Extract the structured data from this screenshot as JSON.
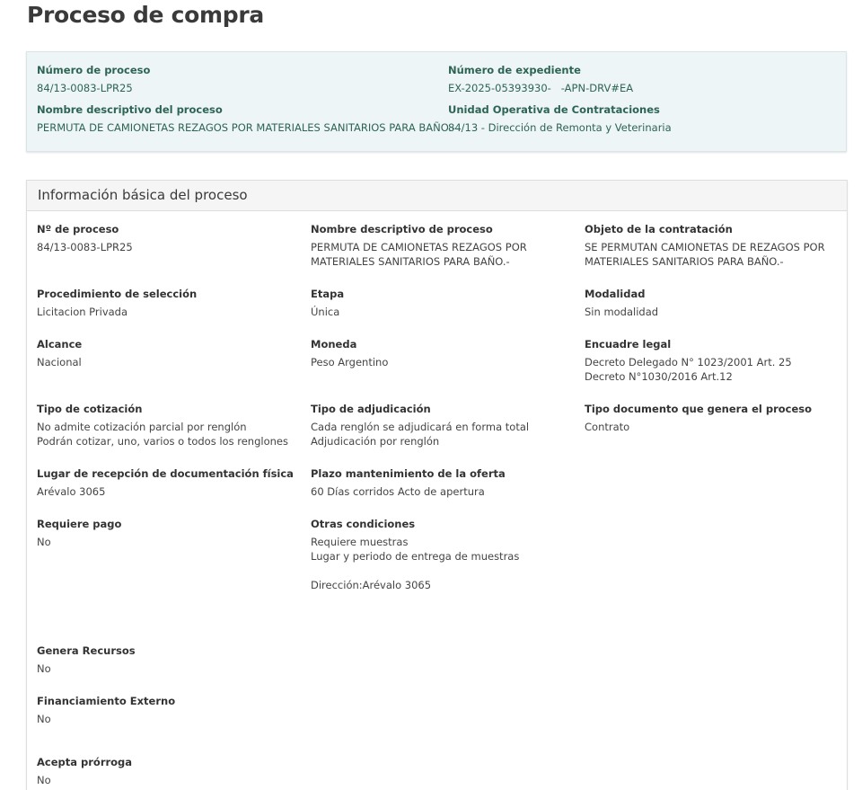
{
  "page": {
    "title": "Proceso de compra"
  },
  "summary": {
    "numero_proceso": {
      "label": "Número de proceso",
      "value": "84/13-0083-LPR25"
    },
    "numero_expediente": {
      "label": "Número de expediente",
      "value": "EX-2025-05393930-   -APN-DRV#EA"
    },
    "nombre_descriptivo": {
      "label": "Nombre descriptivo del proceso",
      "value": "PERMUTA DE CAMIONETAS REZAGOS POR MATERIALES SANITARIOS PARA BAÑO.-"
    },
    "unidad_operativa": {
      "label": "Unidad Operativa de Contrataciones",
      "value": "84/13 - Dirección de Remonta y Veterinaria"
    }
  },
  "info": {
    "title": "Información básica del proceso",
    "nro_proceso": {
      "label": "Nº de proceso",
      "lines": [
        "84/13-0083-LPR25"
      ]
    },
    "nombre_descriptivo": {
      "label": "Nombre descriptivo de proceso",
      "lines": [
        "PERMUTA DE CAMIONETAS REZAGOS POR",
        "MATERIALES SANITARIOS PARA BAÑO.-"
      ]
    },
    "objeto": {
      "label": "Objeto de la contratación",
      "lines": [
        "SE PERMUTAN CAMIONETAS DE REZAGOS POR",
        "MATERIALES SANITARIOS PARA BAÑO.-"
      ]
    },
    "procedimiento": {
      "label": "Procedimiento de selección",
      "lines": [
        "Licitacion Privada"
      ]
    },
    "etapa": {
      "label": "Etapa",
      "lines": [
        "Única"
      ]
    },
    "modalidad": {
      "label": "Modalidad",
      "lines": [
        "Sin modalidad"
      ]
    },
    "alcance": {
      "label": "Alcance",
      "lines": [
        "Nacional"
      ]
    },
    "moneda": {
      "label": "Moneda",
      "lines": [
        "Peso Argentino"
      ]
    },
    "encuadre": {
      "label": "Encuadre legal",
      "lines": [
        "Decreto Delegado N° 1023/2001 Art. 25",
        "Decreto N°1030/2016 Art.12"
      ]
    },
    "tipo_cotizacion": {
      "label": "Tipo de cotización",
      "lines": [
        "No admite cotización parcial por renglón",
        "Podrán cotizar, uno, varios o todos los renglones"
      ]
    },
    "tipo_adjudicacion": {
      "label": "Tipo de adjudicación",
      "lines": [
        "Cada renglón se adjudicará en forma total",
        "Adjudicación por renglón"
      ]
    },
    "tipo_documento": {
      "label": "Tipo documento que genera el proceso",
      "lines": [
        "Contrato"
      ]
    },
    "lugar_recepcion": {
      "label": "Lugar de recepción de documentación física",
      "lines": [
        "Arévalo 3065"
      ]
    },
    "plazo": {
      "label": "Plazo mantenimiento de la oferta",
      "lines": [
        "60 Días corridos Acto de apertura"
      ]
    },
    "requiere_pago": {
      "label": "Requiere pago",
      "lines": [
        "No"
      ]
    },
    "otras": {
      "label": "Otras condiciones",
      "lines": [
        "Requiere muestras",
        "Lugar y periodo de entrega de muestras",
        "",
        "Dirección:Arévalo 3065"
      ]
    },
    "genera_recursos": {
      "label": "Genera Recursos",
      "lines": [
        "No"
      ]
    },
    "financiamiento": {
      "label": "Financiamiento Externo",
      "lines": [
        "No"
      ]
    },
    "prorroga": {
      "label": "Acepta prórroga",
      "lines": [
        "No"
      ]
    }
  }
}
